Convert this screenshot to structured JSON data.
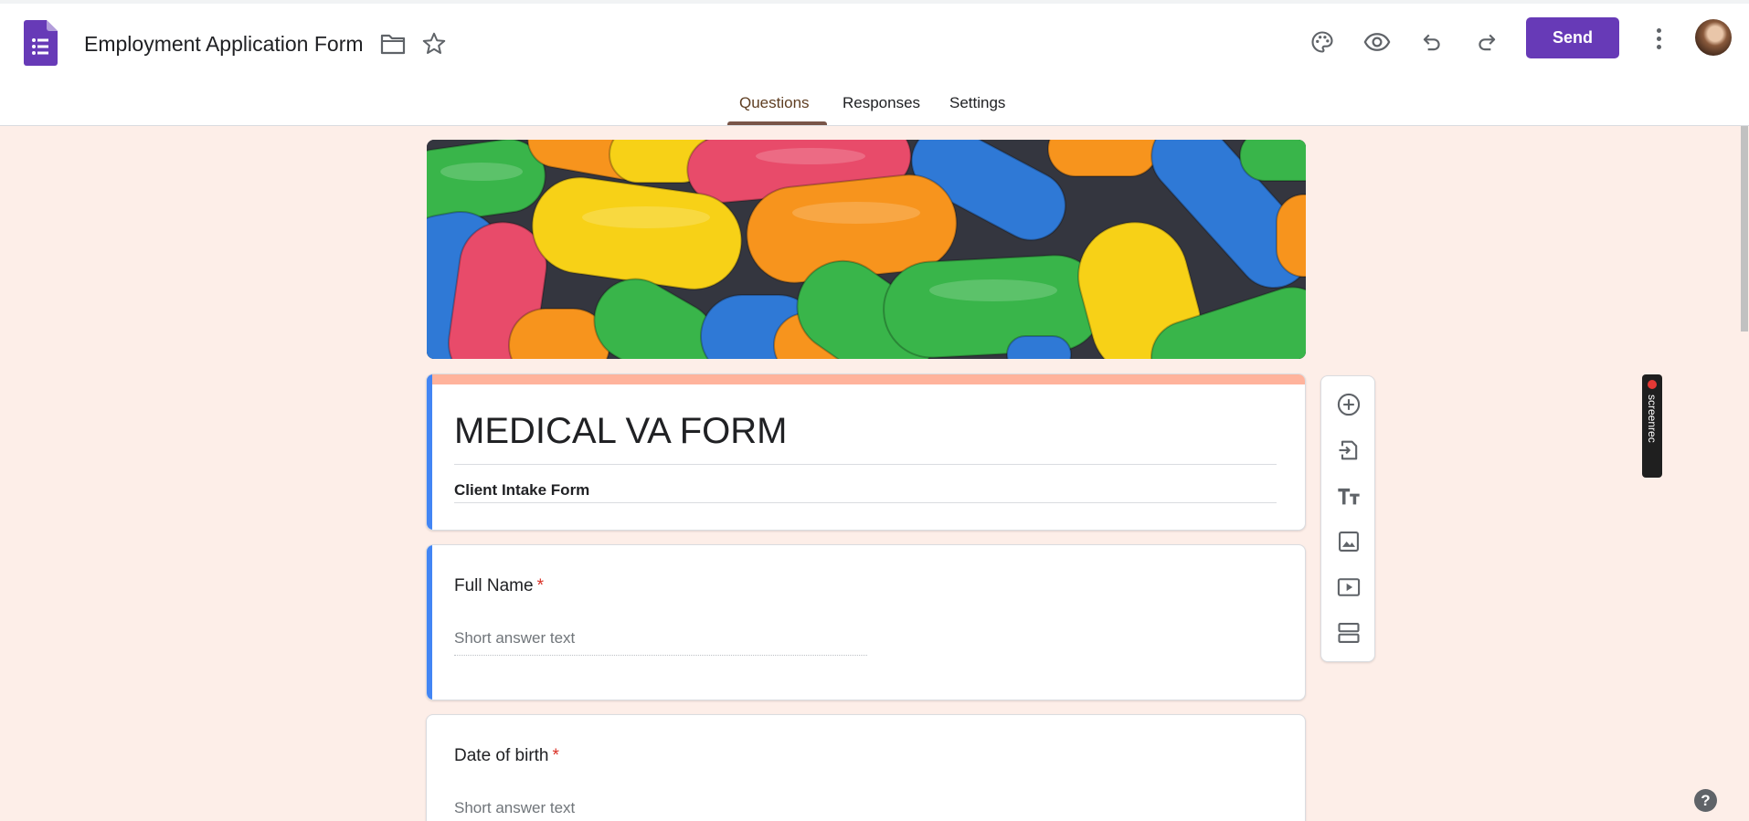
{
  "app": {
    "title": "Employment Application Form",
    "icons": [
      "forms-app-icon",
      "folder-icon",
      "star-icon"
    ]
  },
  "header_actions": {
    "icons": [
      "palette-icon",
      "eye-icon",
      "undo-icon",
      "redo-icon",
      "more-vert-icon"
    ],
    "send_label": "Send",
    "accent_color": "#673ab7"
  },
  "tabs": [
    {
      "label": "Questions",
      "active": true
    },
    {
      "label": "Responses",
      "active": false
    },
    {
      "label": "Settings",
      "active": false
    }
  ],
  "form": {
    "title": "MEDICAL VA FORM",
    "description": "Client Intake Form",
    "theme_color": "#ffb39c",
    "background_color": "#fdeee8"
  },
  "questions": [
    {
      "label": "Full Name",
      "required_mark": "*",
      "placeholder": "Short answer text"
    },
    {
      "label": "Date of birth",
      "required_mark": "*",
      "placeholder": "Short answer text"
    }
  ],
  "side_toolbar": {
    "icons": [
      "add-question-icon",
      "import-questions-icon",
      "add-title-icon",
      "add-image-icon",
      "add-video-icon",
      "add-section-icon"
    ]
  },
  "screenrec": {
    "label": "screenrec"
  },
  "help": {
    "label": "?"
  }
}
